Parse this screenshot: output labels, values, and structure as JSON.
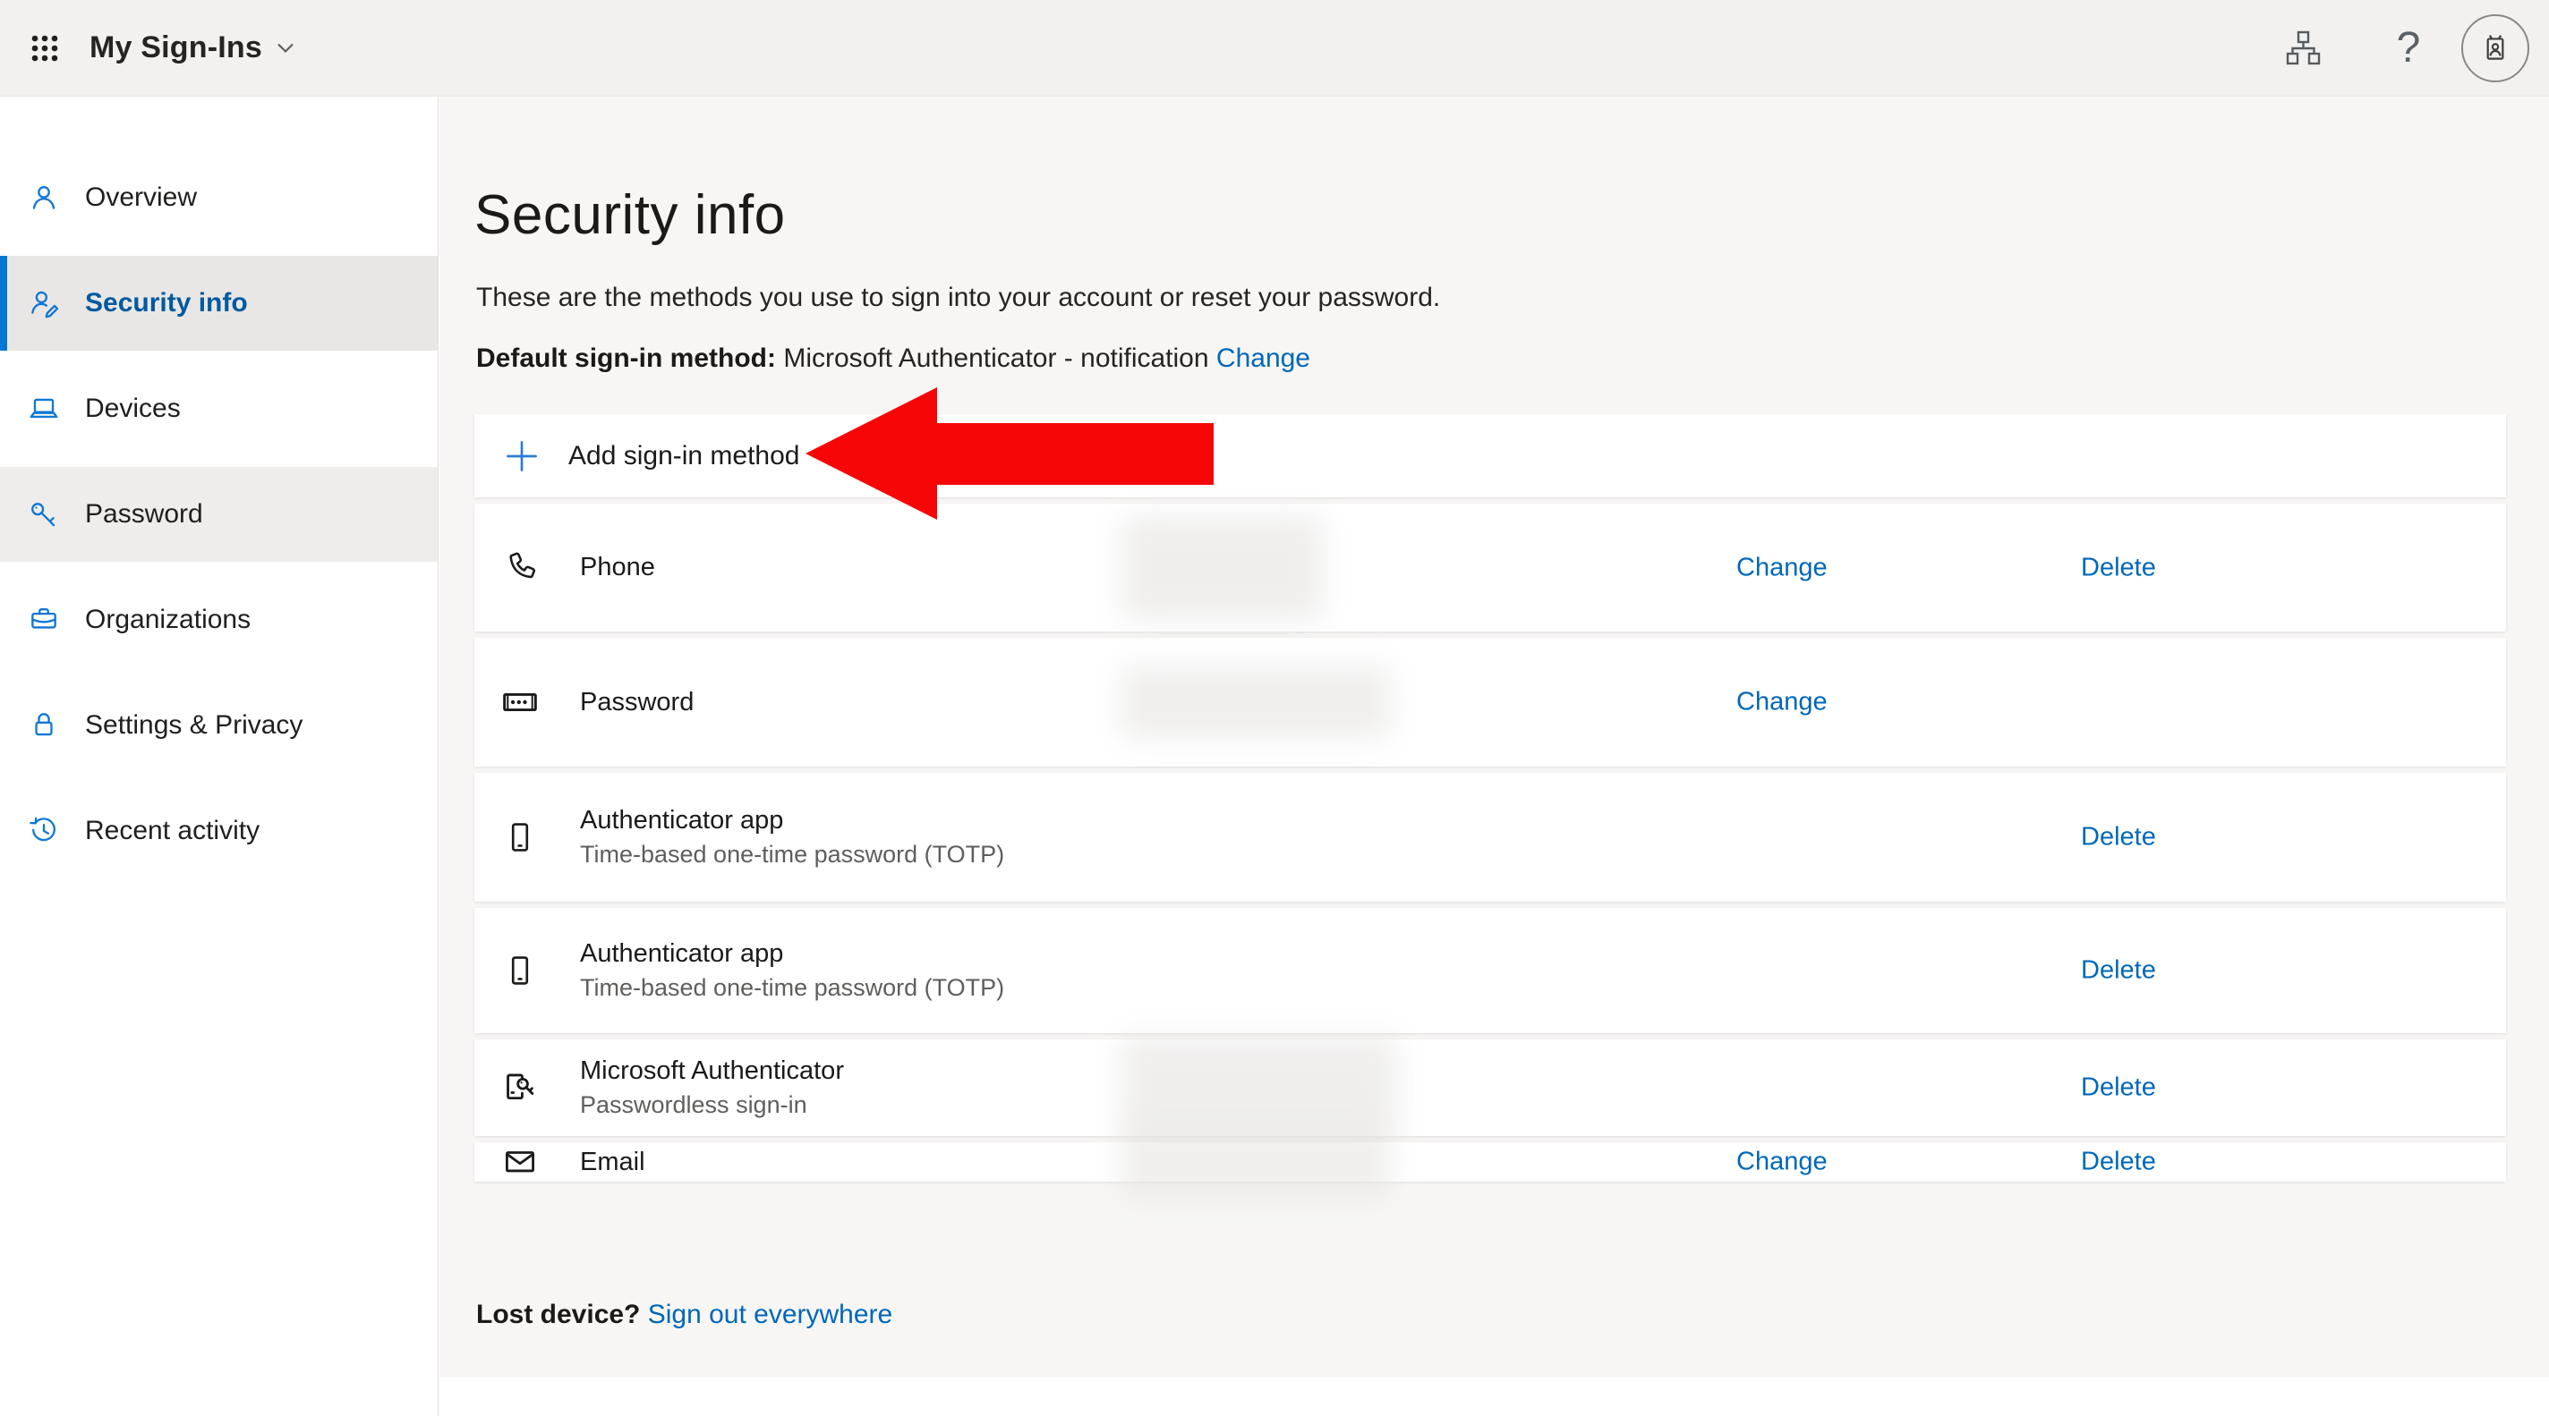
{
  "header": {
    "title": "My Sign-Ins",
    "help_glyph": "?",
    "icons": [
      "app-launcher-icon",
      "chevron-down-icon",
      "org-chart-icon",
      "help-icon",
      "avatar-badge-icon"
    ]
  },
  "sidebar": {
    "items": [
      {
        "icon": "person-icon",
        "label": "Overview",
        "selected": false,
        "highlighted": false
      },
      {
        "icon": "person-edit-icon",
        "label": "Security info",
        "selected": true,
        "highlighted": false
      },
      {
        "icon": "laptop-icon",
        "label": "Devices",
        "selected": false,
        "highlighted": false
      },
      {
        "icon": "key-icon",
        "label": "Password",
        "selected": false,
        "highlighted": true
      },
      {
        "icon": "briefcase-icon",
        "label": "Organizations",
        "selected": false,
        "highlighted": false
      },
      {
        "icon": "lock-icon",
        "label": "Settings & Privacy",
        "selected": false,
        "highlighted": false
      },
      {
        "icon": "history-icon",
        "label": "Recent activity",
        "selected": false,
        "highlighted": false
      }
    ]
  },
  "main": {
    "title": "Security info",
    "description": "These are the methods you use to sign into your account or reset your password.",
    "default_method": {
      "label": "Default sign-in method:",
      "value": "Microsoft Authenticator - notification",
      "change_label": "Change"
    },
    "add_method": {
      "icon": "plus-icon",
      "label": "Add sign-in method"
    },
    "methods": [
      {
        "icon": "phone-handset-icon",
        "label": "Phone",
        "sublabel": "",
        "value_hidden": true,
        "actions": [
          "change",
          "delete"
        ]
      },
      {
        "icon": "password-field-icon",
        "label": "Password",
        "sublabel": "",
        "value_hidden": true,
        "actions": [
          "change"
        ]
      },
      {
        "icon": "mobile-device-icon",
        "label": "Authenticator app",
        "sublabel": "Time-based one-time password (TOTP)",
        "value_hidden": false,
        "actions": [
          "delete"
        ]
      },
      {
        "icon": "mobile-device-icon",
        "label": "Authenticator app",
        "sublabel": "Time-based one-time password (TOTP)",
        "value_hidden": false,
        "actions": [
          "delete"
        ]
      },
      {
        "icon": "device-key-icon",
        "label": "Microsoft Authenticator",
        "sublabel": "Passwordless sign-in",
        "value_hidden": true,
        "actions": [
          "delete"
        ]
      },
      {
        "icon": "envelope-icon",
        "label": "Email",
        "sublabel": "",
        "value_hidden": true,
        "actions": [
          "change",
          "delete"
        ]
      }
    ],
    "action_labels": {
      "change": "Change",
      "delete": "Delete"
    },
    "lost_device": {
      "label": "Lost device?",
      "link": "Sign out everywhere"
    }
  },
  "annotation": {
    "type": "arrow-left",
    "color": "#f60606",
    "points_at": "Add sign-in method"
  }
}
